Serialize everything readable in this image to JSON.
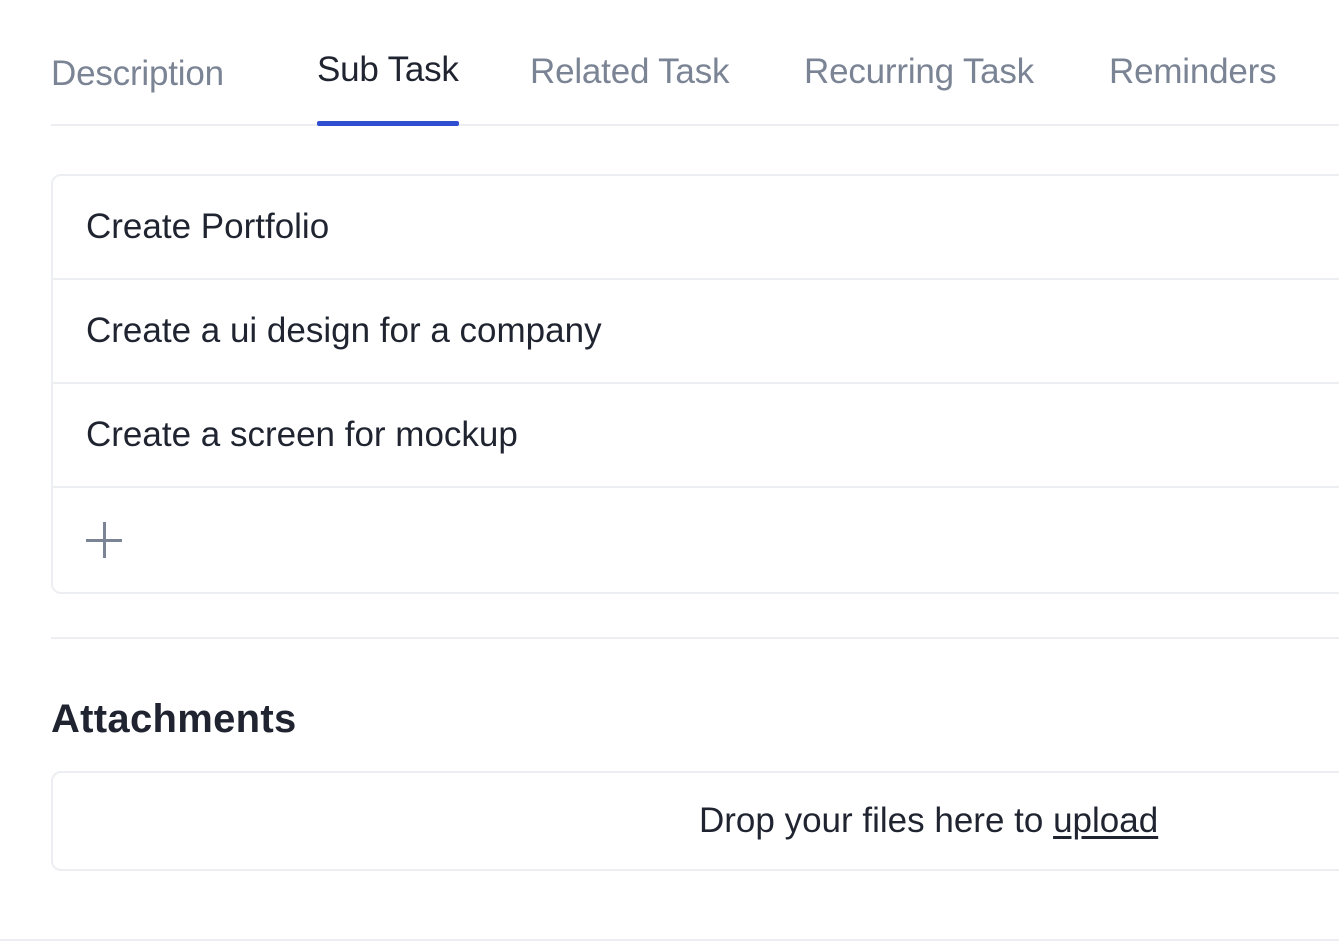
{
  "tabs": [
    {
      "label": "Description",
      "active": false
    },
    {
      "label": "Sub Task",
      "active": true
    },
    {
      "label": "Related Task",
      "active": false
    },
    {
      "label": "Recurring Task",
      "active": false
    },
    {
      "label": "Reminders",
      "active": false
    }
  ],
  "subtasks": {
    "items": [
      {
        "title": "Create Portfolio"
      },
      {
        "title": "Create a ui design for a company"
      },
      {
        "title": "Create a screen for mockup"
      }
    ],
    "add_icon": "plus-icon"
  },
  "attachments": {
    "title": "Attachments",
    "dropzone_text": "Drop your files here to ",
    "upload_link": "upload"
  },
  "colors": {
    "accent": "#2f4fd0",
    "text_primary": "#1f2430",
    "text_muted": "#7b8494",
    "border": "#eceef1"
  }
}
